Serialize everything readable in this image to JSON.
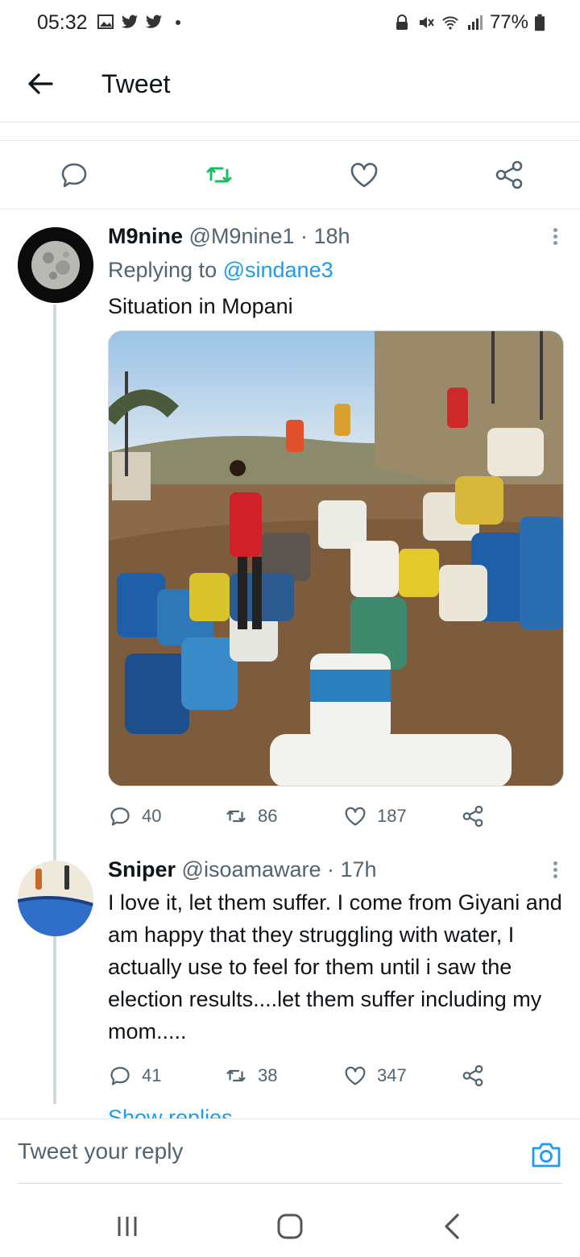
{
  "status_bar": {
    "time": "05:32",
    "battery": "77%",
    "left_icons": [
      "gallery-icon",
      "twitter-icon",
      "twitter-icon",
      "dot-icon"
    ],
    "right_icons": [
      "vpn-icon",
      "mute-icon",
      "wifi-icon",
      "signal-icon",
      "battery-icon"
    ]
  },
  "header": {
    "title": "Tweet",
    "back_icon": "arrow-left-icon"
  },
  "parent_actions": [
    "reply-icon",
    "retweet-icon",
    "like-icon",
    "share-icon"
  ],
  "tweets": [
    {
      "name": "M9nine",
      "handle": "@M9nine1",
      "sep": " · ",
      "time": "18h",
      "replying_prefix": "Replying to ",
      "replying_to": "@sindane3",
      "text": "Situation in Mopani",
      "has_media": true,
      "replies": "40",
      "retweets": "86",
      "likes": "187"
    },
    {
      "name": "Sniper",
      "handle": "@isoamaware",
      "sep": " · ",
      "time": "17h",
      "text": "I love it, let them suffer. I come from Giyani and am happy that they struggling with water, I actually use to feel for them until i saw the election results....let them suffer including my mom.....",
      "replies": "41",
      "retweets": "38",
      "likes": "347"
    }
  ],
  "show_replies": "Show replies",
  "composer": {
    "placeholder": "Tweet your reply",
    "camera_icon": "camera-icon"
  },
  "nav": [
    "recents-icon",
    "home-icon",
    "back-chevron-icon"
  ],
  "colors": {
    "retweet_green": "#17bf63",
    "link_blue": "#1d9bf0",
    "text": "#0f1419",
    "muted": "#536471"
  }
}
